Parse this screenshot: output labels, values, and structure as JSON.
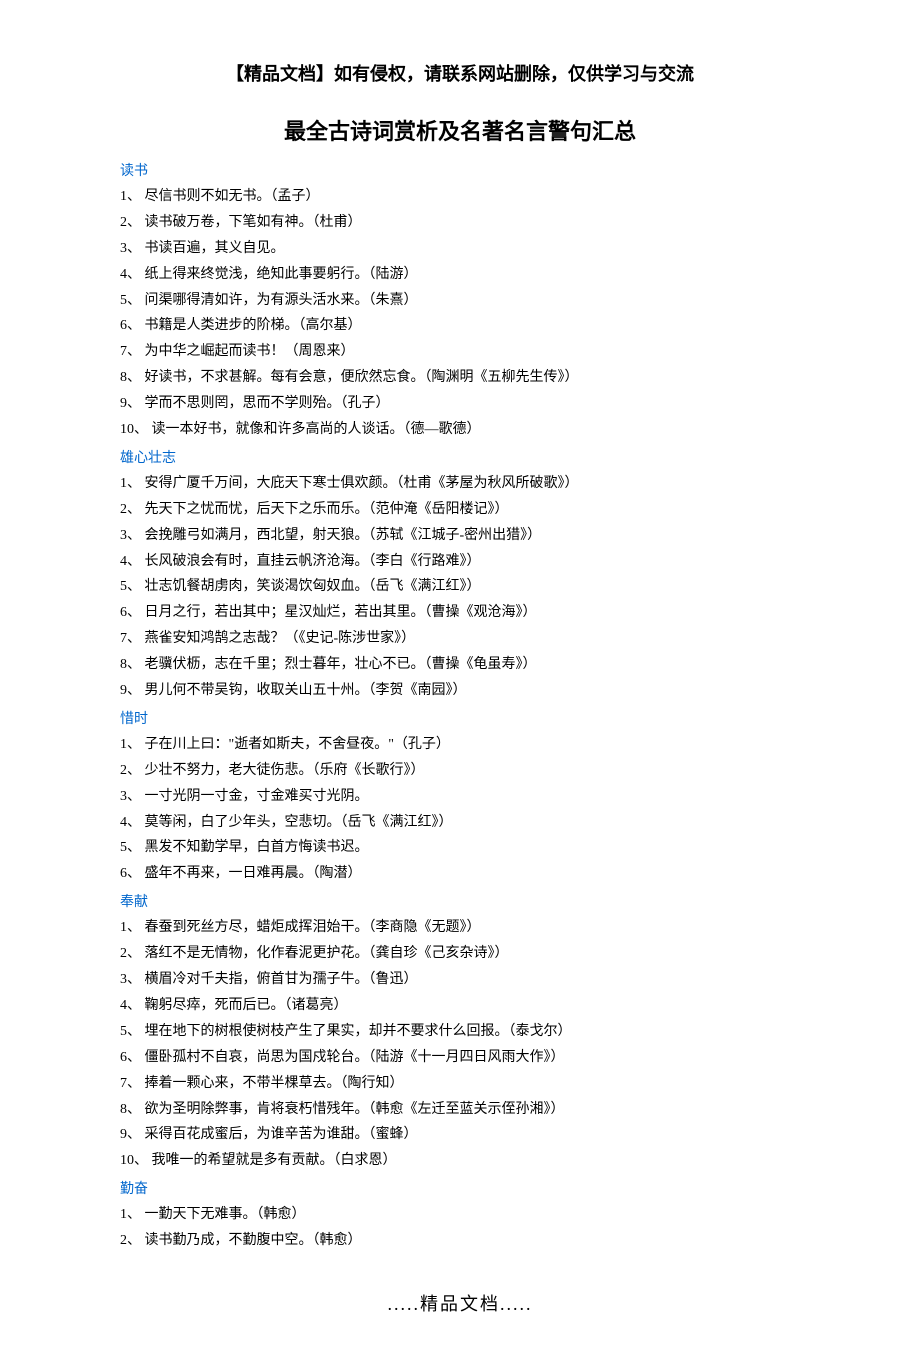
{
  "header_notice": "【精品文档】如有侵权，请联系网站删除，仅供学习与交流",
  "main_title": "最全古诗词赏析及名著名言警句汇总",
  "sections": [
    {
      "heading": "读书",
      "items": [
        "1、 尽信书则不如无书。（孟子）",
        "2、 读书破万卷，下笔如有神。（杜甫）",
        "3、 书读百遍，其义自见。",
        "4、 纸上得来终觉浅，绝知此事要躬行。（陆游）",
        "5、 问渠哪得清如许，为有源头活水来。（朱熹）",
        "6、 书籍是人类进步的阶梯。（高尔基）",
        "7、 为中华之崛起而读书！（周恩来）",
        "8、 好读书，不求甚解。每有会意，便欣然忘食。（陶渊明《五柳先生传》）",
        "9、 学而不思则罔，思而不学则殆。（孔子）",
        "10、 读一本好书，就像和许多高尚的人谈话。（德—歌德）"
      ]
    },
    {
      "heading": "雄心壮志",
      "items": [
        "1、 安得广厦千万间，大庇天下寒士俱欢颜。（杜甫《茅屋为秋风所破歌》）",
        "2、 先天下之忧而忧，后天下之乐而乐。（范仲淹《岳阳楼记》）",
        "3、 会挽雕弓如满月，西北望，射天狼。（苏轼《江城子-密州出猎》）",
        "4、 长风破浪会有时，直挂云帆济沧海。（李白《行路难》）",
        "5、 壮志饥餐胡虏肉，笑谈渴饮匈奴血。（岳飞《满江红》）",
        "6、 日月之行，若出其中；星汉灿烂，若出其里。（曹操《观沧海》）",
        "7、 燕雀安知鸿鹄之志哉？（《史记-陈涉世家》）",
        "8、 老骥伏枥，志在千里；烈士暮年，壮心不已。（曹操《龟虽寿》）",
        "9、 男儿何不带吴钩，收取关山五十州。（李贺《南园》）"
      ]
    },
    {
      "heading": "惜时",
      "items": [
        "1、 子在川上曰：\"逝者如斯夫，不舍昼夜。\"（孔子）",
        "2、 少壮不努力，老大徒伤悲。（乐府《长歌行》）",
        "3、 一寸光阴一寸金，寸金难买寸光阴。",
        "4、 莫等闲，白了少年头，空悲切。（岳飞《满江红》）",
        "5、 黑发不知勤学早，白首方悔读书迟。",
        "6、 盛年不再来，一日难再晨。（陶潜）"
      ]
    },
    {
      "heading": "奉献",
      "items": [
        "1、 春蚕到死丝方尽，蜡炬成挥泪始干。（李商隐《无题》）",
        "2、 落红不是无情物，化作春泥更护花。（龚自珍《己亥杂诗》）",
        "3、 横眉冷对千夫指，俯首甘为孺子牛。（鲁迅）",
        "4、 鞠躬尽瘁，死而后已。（诸葛亮）",
        "5、 埋在地下的树根使树枝产生了果实，却并不要求什么回报。（泰戈尔）",
        "6、 僵卧孤村不自哀，尚思为国戍轮台。（陆游《十一月四日风雨大作》）",
        "7、 捧着一颗心来，不带半棵草去。（陶行知）",
        "8、 欲为圣明除弊事，肯将衰朽惜残年。（韩愈《左迁至蓝关示侄孙湘》）",
        "9、 采得百花成蜜后，为谁辛苦为谁甜。（蜜蜂）",
        "10、 我唯一的希望就是多有贡献。（白求恩）"
      ]
    },
    {
      "heading": "勤奋",
      "items": [
        "1、 一勤天下无难事。（韩愈）",
        "2、 读书勤乃成，不勤腹中空。（韩愈）"
      ]
    }
  ],
  "footer": ".....精品文档....."
}
